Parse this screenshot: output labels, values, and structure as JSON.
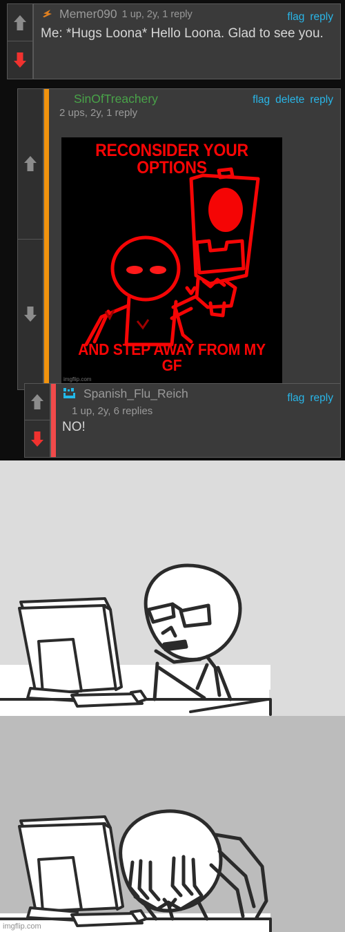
{
  "colors": {
    "page_background": "#0d0d0d",
    "comment_background": "#3a3a3a",
    "comment_border": "#5b5b5b",
    "vote_background": "#2f2f2f",
    "username_default": "#9a9a9a",
    "username_highlight": "#49a349",
    "link_blue": "#29b6e8",
    "accent_orange": "#f2930d",
    "accent_red": "#f04a4a",
    "arrow_gray": "#8c8c8c",
    "arrow_red": "#f0322f",
    "meme_red": "#fa0505",
    "panel1_background": "#dcdcdc",
    "panel2_background": "#bcbcbc",
    "avatar_cyan": "#22b8e8"
  },
  "comments": [
    {
      "id": "comment-1",
      "icon": "lightning-bolt-icon",
      "username": "Memer090",
      "username_color": "default",
      "meta": "1 up, 2y, 1 reply",
      "actions": [
        "flag",
        "reply"
      ],
      "text": "Me: *Hugs Loona* Hello Loona. Glad to see you.",
      "upvote_state": "inactive",
      "downvote_state": "active",
      "accent_bar": null
    },
    {
      "id": "comment-2",
      "icon": null,
      "username": "SinOfTreachery",
      "username_color": "green",
      "meta": "2 ups, 2y, 1 reply",
      "actions": [
        "flag",
        "delete",
        "reply"
      ],
      "text": "",
      "upvote_state": "inactive",
      "downvote_state": "inactive",
      "accent_bar": "orange",
      "attached_image": {
        "name": "reconsider-your-options-meme",
        "top_text": "RECONSIDER YOUR OPTIONS",
        "bottom_text": "AND STEP AWAY FROM MY GF",
        "watermark": "imgflip.com"
      }
    },
    {
      "id": "comment-3",
      "icon": "pixel-smiley-avatar-icon",
      "username": "Spanish_Flu_Reich",
      "username_color": "default",
      "meta": "1 up, 2y, 6 replies",
      "actions": [
        "flag",
        "reply"
      ],
      "text": "NO!",
      "upvote_state": "inactive",
      "downvote_state": "active",
      "accent_bar": "red"
    }
  ],
  "panels": [
    {
      "id": "panel-1",
      "name": "computer-guy-angry-panel",
      "description": "Computer Guy stick figure scowling at monitor",
      "watermark": null
    },
    {
      "id": "panel-2",
      "name": "computer-guy-facepalm-panel",
      "description": "Computer Guy stick figure with head in hands facepalming at monitor",
      "watermark": "imgflip.com"
    }
  ]
}
